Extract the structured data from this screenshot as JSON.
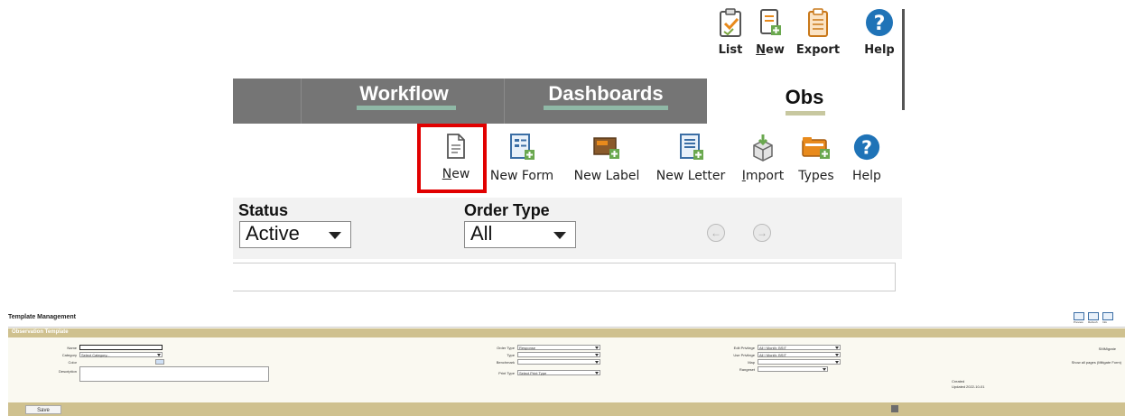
{
  "top_bar": {
    "items": [
      {
        "label": "List",
        "icon": "clipboard-check-icon"
      },
      {
        "label": "New",
        "icon": "document-add-icon"
      },
      {
        "label": "Export",
        "icon": "clipboard-export-icon"
      },
      {
        "label": "Help",
        "icon": "help-circle-icon"
      }
    ]
  },
  "nav": {
    "tabs": [
      {
        "label": "Workflow"
      },
      {
        "label": "Dashboards"
      },
      {
        "label": "Obs",
        "active": true
      }
    ]
  },
  "toolbar": {
    "items": [
      {
        "label": "New",
        "icon": "new-document-icon",
        "highlighted": true
      },
      {
        "label": "New Form",
        "icon": "new-form-icon"
      },
      {
        "label": "New Label",
        "icon": "new-label-icon"
      },
      {
        "label": "New Letter",
        "icon": "new-letter-icon"
      },
      {
        "label": "Import",
        "icon": "import-box-icon"
      },
      {
        "label": "Types",
        "icon": "types-folder-icon"
      },
      {
        "label": "Help",
        "icon": "help-circle-icon"
      }
    ]
  },
  "filters": {
    "status_label": "Status",
    "status_value": "Active",
    "order_type_label": "Order Type",
    "order_type_value": "All"
  },
  "template_mgmt": {
    "title": "Template Management",
    "section": "Observation Template",
    "fields": {
      "name_label": "Name",
      "category_label": "Category",
      "category_value": "Select Category...",
      "color_label": "Color",
      "description_label": "Description",
      "order_type_label": "Order Type",
      "order_type_value": "Response",
      "type_label": "Type",
      "benchmark_label": "Benchmark",
      "print_type_label": "Print Type",
      "print_type_value": "Select Print Type",
      "edit_privilege_label": "Edit Privilege",
      "edit_privilege_value": "All I Month: BSIT",
      "use_privilege_label": "Use Privilege",
      "use_privilege_value": "All I Month: BSIT",
      "map_label": "Map",
      "rangeset_label": "Rangeset",
      "created_label": "Created",
      "updated_label": "Updated",
      "updated_value": "2022-10-01",
      "smmigrate_label": "SMMigrate",
      "show_all_pages_label": "Show all pages (Mitigate Form)"
    },
    "save_label": "Save",
    "header_icons": [
      "Preview",
      "Refresh",
      "Info"
    ]
  },
  "colors": {
    "nav_bg": "#757575",
    "tab_underline": "#8fb8a6",
    "highlight_border": "#e10000",
    "panel_header": "#cfc18f"
  }
}
